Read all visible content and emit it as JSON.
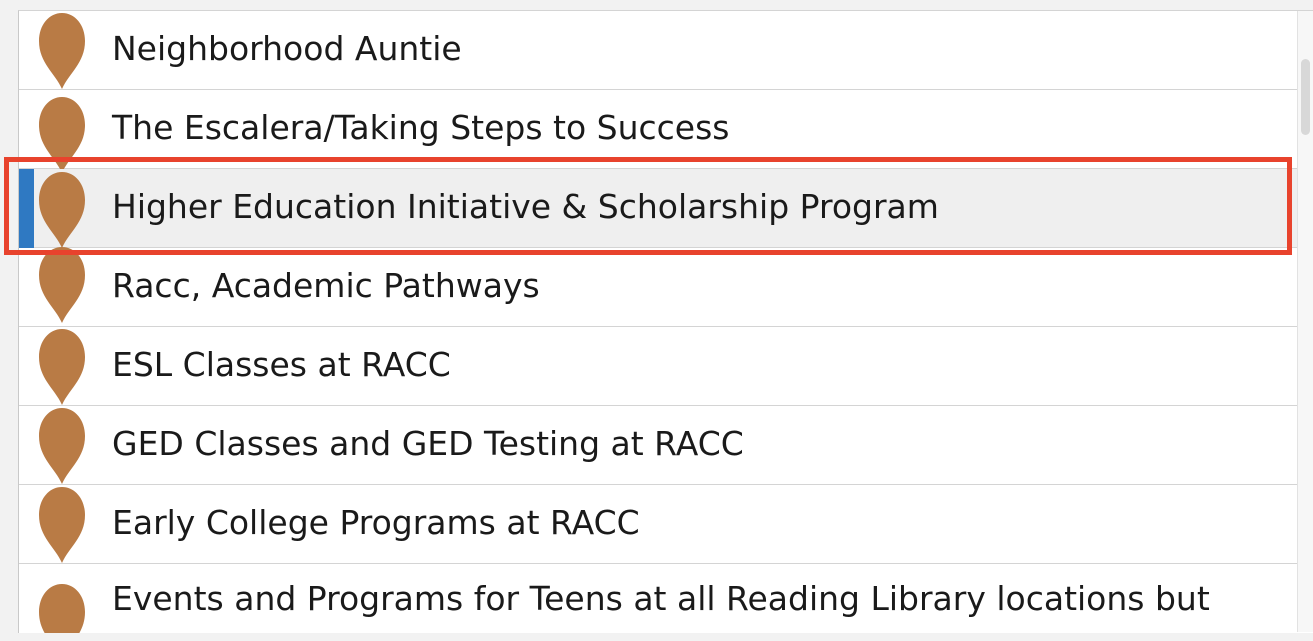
{
  "list": {
    "items": [
      {
        "label": "Neighborhood Auntie"
      },
      {
        "label": "The Escalera/Taking Steps to Success"
      },
      {
        "label": "Higher Education Initiative & Scholarship Program"
      },
      {
        "label": "Racc, Academic Pathways"
      },
      {
        "label": "ESL Classes at RACC"
      },
      {
        "label": "GED Classes and GED Testing at RACC"
      },
      {
        "label": "Early College Programs at RACC"
      },
      {
        "label": "Events and Programs for Teens at all Reading Library locations but"
      }
    ],
    "selected_index": 2
  },
  "icons": {
    "row_icon": "map-pin-icon"
  },
  "colors": {
    "pin": "#b97b45",
    "selection_bar": "#2f79c2",
    "highlight_border": "#e8432d",
    "selected_row_bg": "#efefef"
  }
}
